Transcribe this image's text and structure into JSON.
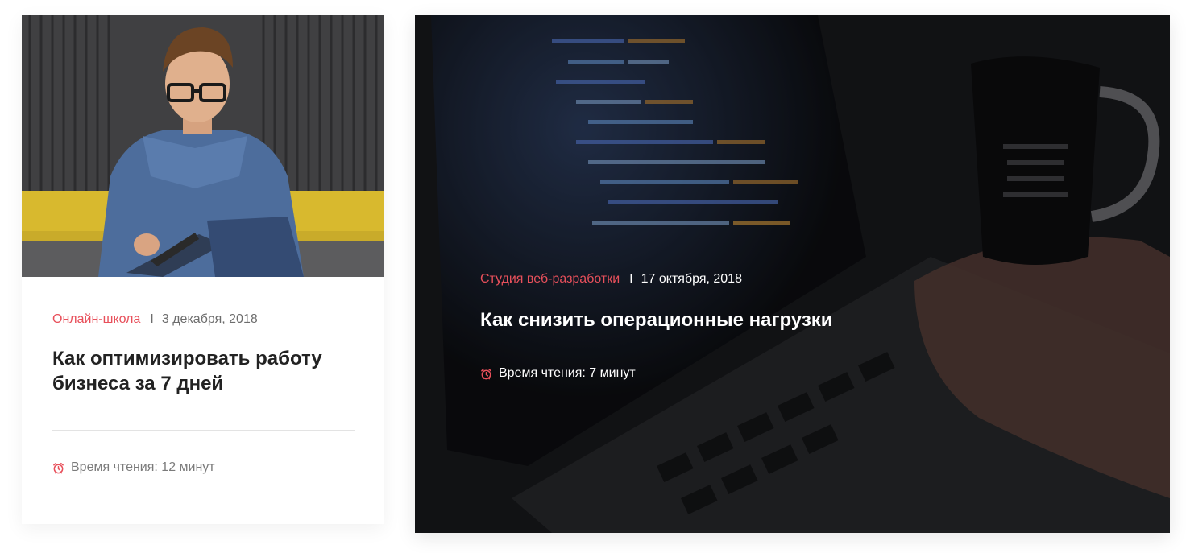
{
  "accent_color": "#e8505b",
  "cards": [
    {
      "category": "Онлайн-школа",
      "separator": "I",
      "date": "3 декабря, 2018",
      "title": "Как оптимизировать работу бизнеса за 7 дней",
      "reading_time": "Время чтения: 12 минут",
      "icon": "alarm-clock-icon"
    },
    {
      "category": "Студия веб-разработки",
      "separator": "I",
      "date": "17 октября, 2018",
      "title": "Как снизить операционные нагрузки",
      "reading_time": "Время чтения: 7 минут",
      "icon": "alarm-clock-icon"
    }
  ]
}
